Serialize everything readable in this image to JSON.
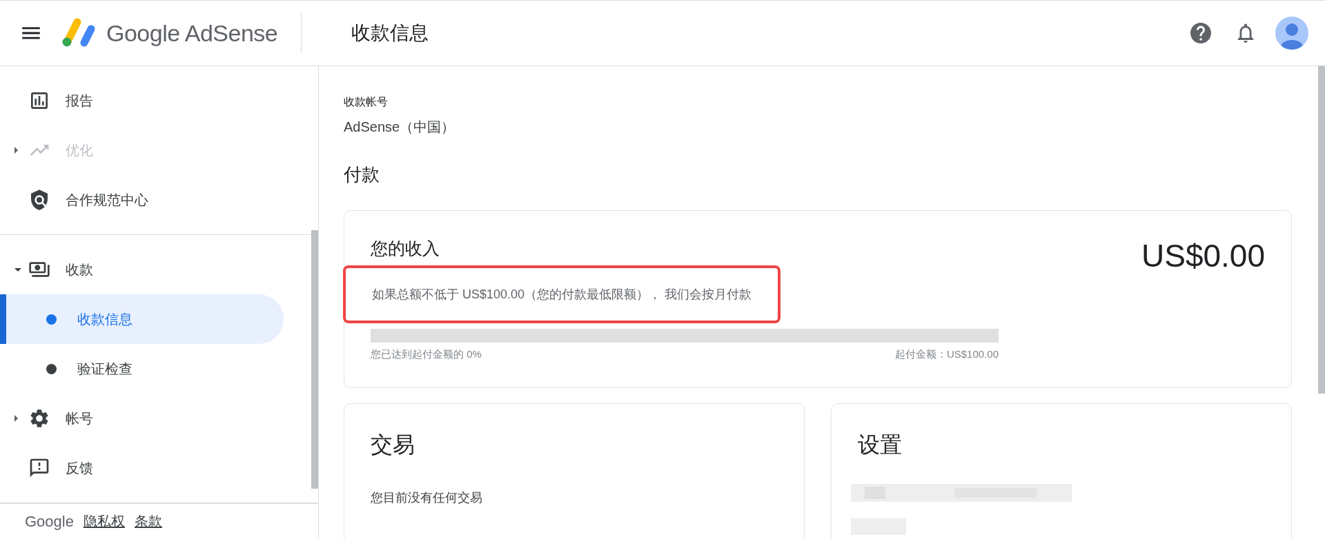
{
  "header": {
    "product": "Google AdSense",
    "page_title": "收款信息"
  },
  "sidebar": {
    "items": [
      {
        "kind": "link",
        "label": "报告",
        "disabled": false
      },
      {
        "kind": "group",
        "label": "优化",
        "disabled": true,
        "expanded": false
      },
      {
        "kind": "link",
        "label": "合作规范中心",
        "disabled": false
      },
      {
        "kind": "group",
        "label": "收款",
        "disabled": false,
        "expanded": true,
        "children": [
          {
            "label": "收款信息",
            "selected": true
          },
          {
            "label": "验证检查",
            "selected": false
          }
        ]
      },
      {
        "kind": "group",
        "label": "帐号",
        "disabled": false,
        "expanded": false
      },
      {
        "kind": "link",
        "label": "反馈",
        "disabled": false
      }
    ],
    "footer": {
      "brand": "Google",
      "links": [
        "隐私权",
        "条款"
      ]
    }
  },
  "account": {
    "label": "收款帐号",
    "value": "AdSense（中国）"
  },
  "payments": {
    "heading": "付款",
    "earnings": {
      "title": "您的收入",
      "amount": "US$0.00",
      "description": "如果总额不低于 US$100.00（您的付款最低限额）， 我们会按月付款",
      "highlighted": true,
      "level": 0,
      "progress_label": "您已达到起付金额的 0%",
      "threshold_label": "起付金额：US$100.00"
    }
  },
  "transactions": {
    "title": "交易",
    "empty_text": "您目前没有任何交易"
  },
  "settings": {
    "title": "设置"
  }
}
